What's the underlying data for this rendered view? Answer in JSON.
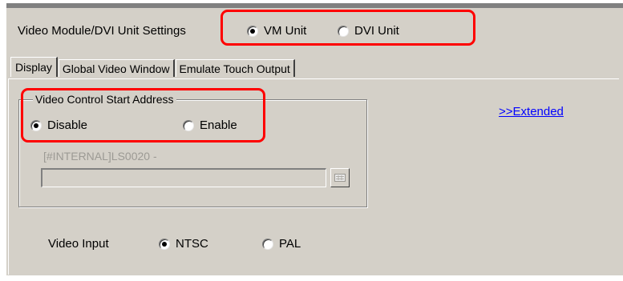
{
  "settings": {
    "label": "Video Module/DVI Unit Settings",
    "options": [
      {
        "label": "VM Unit",
        "checked": true
      },
      {
        "label": "DVI Unit",
        "checked": false
      }
    ]
  },
  "tabs": [
    {
      "label": "Display",
      "active": true
    },
    {
      "label": "Global Video Window",
      "active": false
    },
    {
      "label": "Emulate Touch Output",
      "active": false
    }
  ],
  "video_control": {
    "title": "Video Control Start Address",
    "options": [
      {
        "label": "Disable",
        "checked": true
      },
      {
        "label": "Enable",
        "checked": false
      }
    ],
    "address_text": "[#INTERNAL]LS0020 -",
    "address_value": ""
  },
  "extended_link": ">>Extended",
  "video_input": {
    "label": "Video Input",
    "options": [
      {
        "label": "NTSC",
        "checked": true
      },
      {
        "label": "PAL",
        "checked": false
      }
    ]
  },
  "icons": {
    "keypad": "keypad-icon"
  },
  "colors": {
    "background": "#d4d0c8",
    "highlight": "#ff0000",
    "link": "#0000ff",
    "disabled_text": "#9c9a94"
  }
}
